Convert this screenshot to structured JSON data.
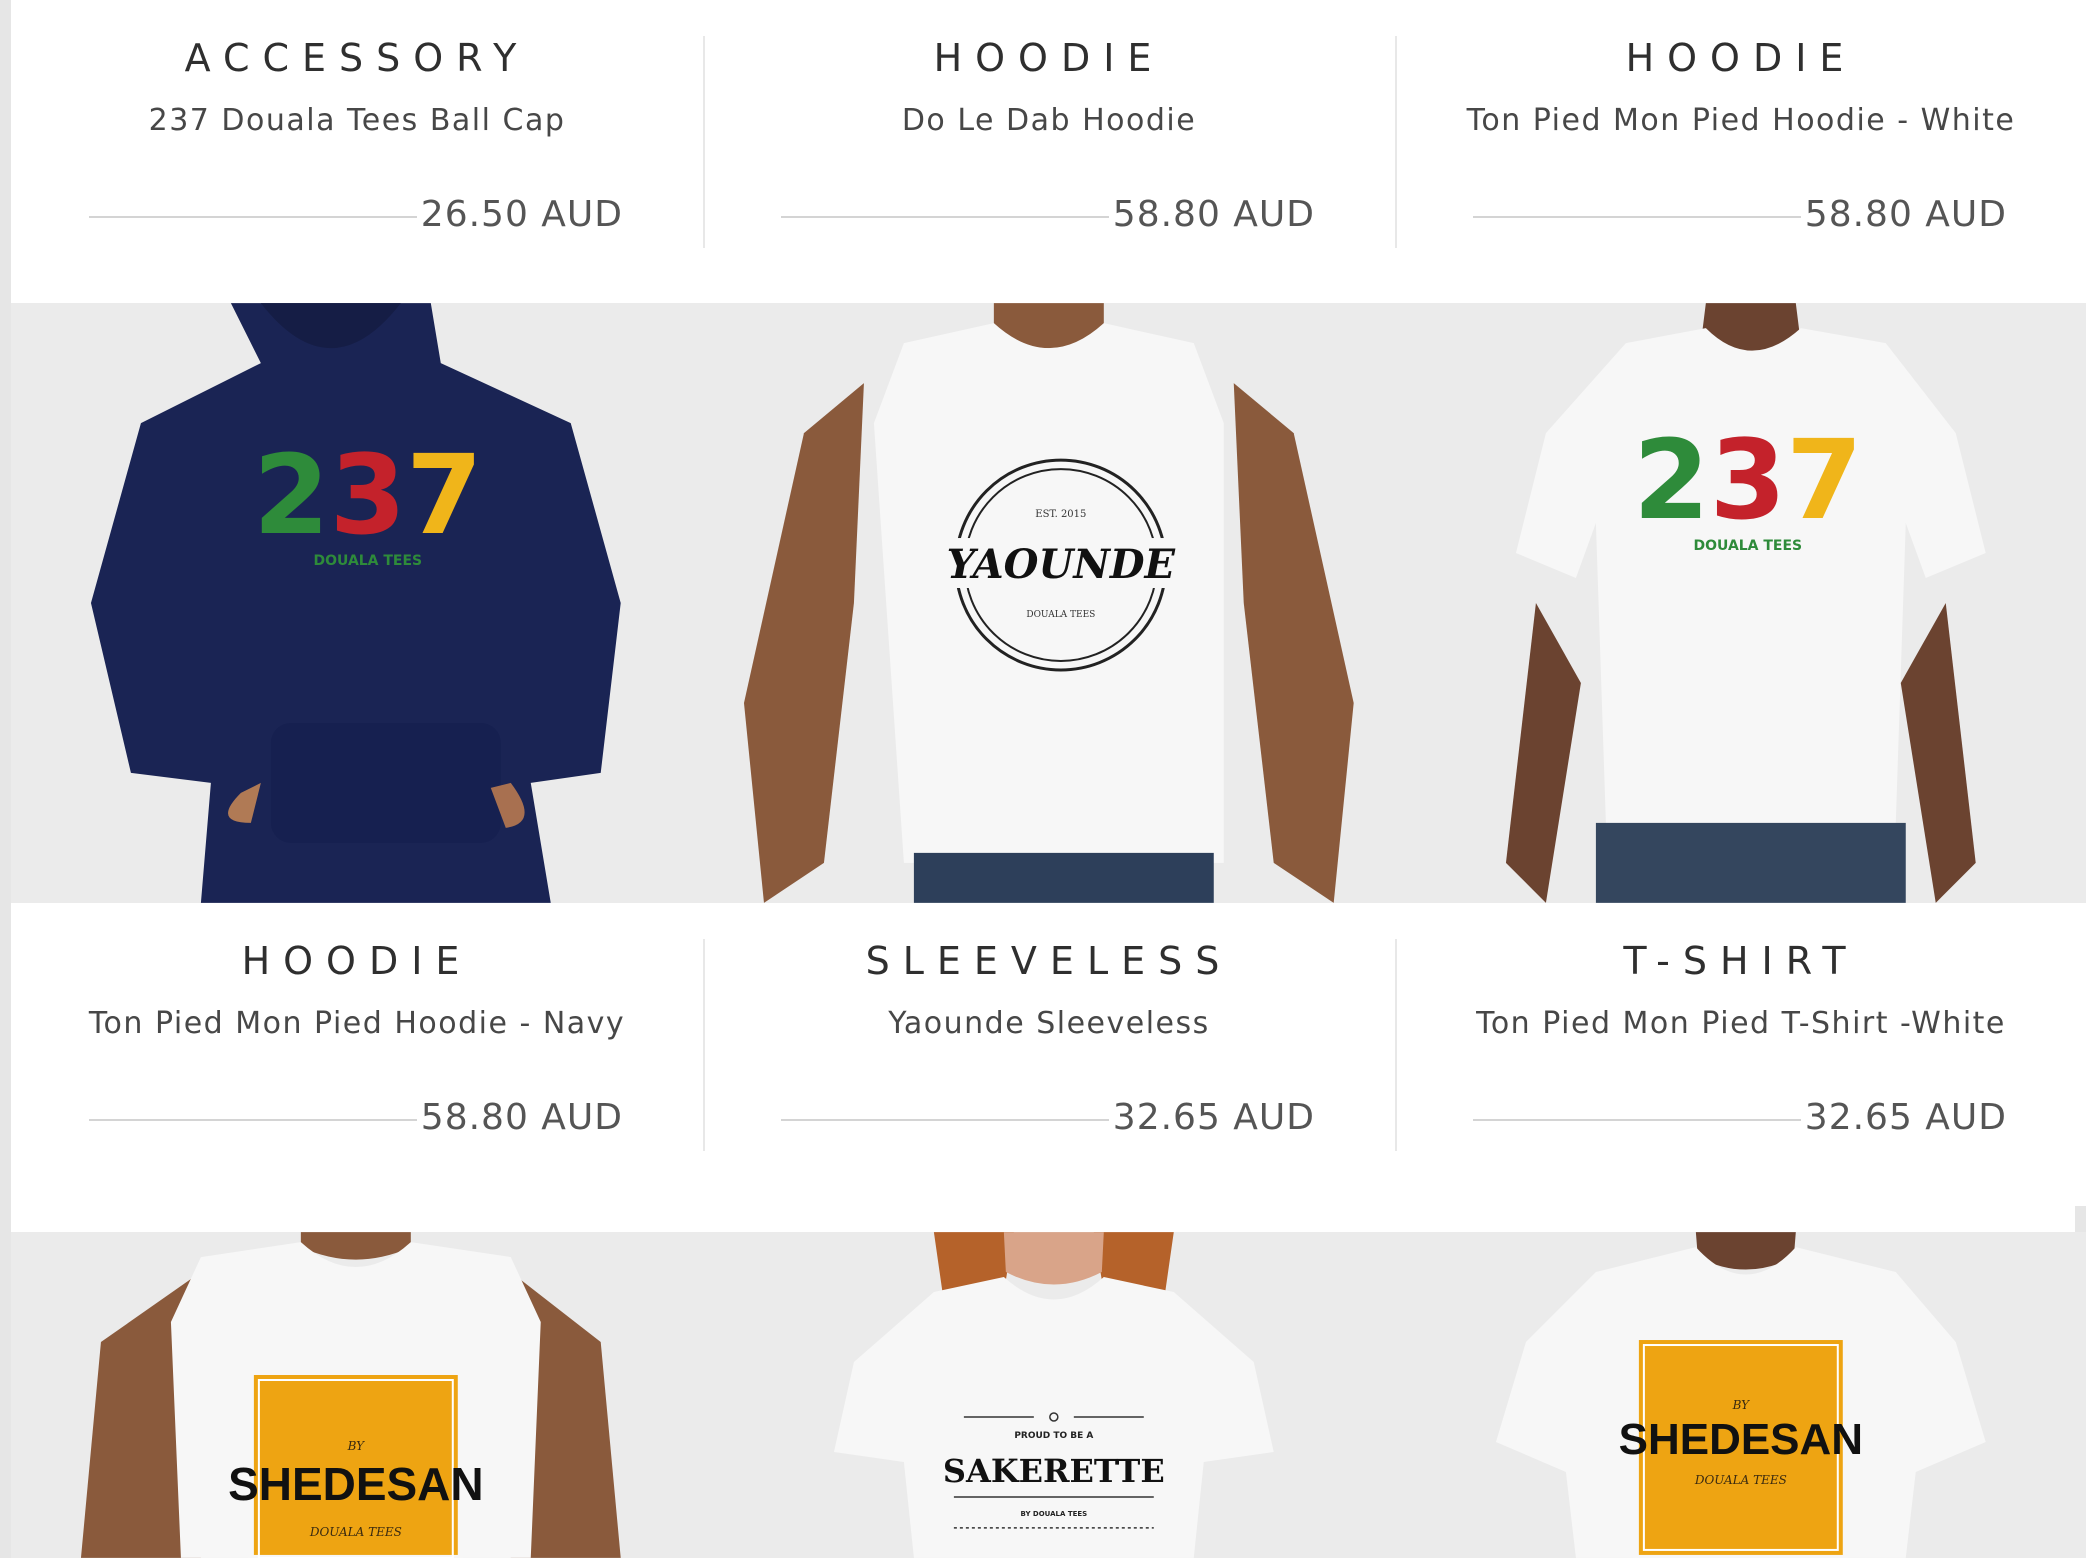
{
  "rows": [
    {
      "items": [
        {
          "category": "ACCESSORY",
          "name": "237 Douala Tees Ball Cap",
          "price": "26.50 AUD"
        },
        {
          "category": "HOODIE",
          "name": "Do Le Dab Hoodie",
          "price": "58.80 AUD"
        },
        {
          "category": "HOODIE",
          "name": "Ton Pied Mon Pied Hoodie - White",
          "price": "58.80 AUD"
        }
      ]
    },
    {
      "items": [
        {
          "category": "HOODIE",
          "name": "Ton Pied Mon Pied Hoodie - Navy",
          "price": "58.80 AUD"
        },
        {
          "category": "SLEEVELESS",
          "name": "Yaounde Sleeveless",
          "price": "32.65 AUD"
        },
        {
          "category": "T-SHIRT",
          "name": "Ton Pied Mon Pied T-Shirt -White",
          "price": "32.65 AUD"
        }
      ]
    }
  ],
  "images_row1": [
    {
      "design": "237 hoodie",
      "big": "237",
      "small": "DOUALA TEES",
      "garment_color": "#1a2454"
    },
    {
      "design": "yaounde sleeveless",
      "top": "EST. 2015",
      "big": "YAOUNDE",
      "small": "DOUALA TEES",
      "garment_color": "#f7f7f7"
    },
    {
      "design": "237 tee",
      "big": "237",
      "small": "DOUALA TEES",
      "garment_color": "#f7f7f7"
    }
  ],
  "images_row2": [
    {
      "design": "shedesan sleeveless",
      "top": "BY",
      "big": "SHEDESAN",
      "small": "DOUALA TEES",
      "badge_color": "#eea412"
    },
    {
      "design": "sakerette tee",
      "top": "PROUD TO BE A",
      "big": "SAKERETTE",
      "small": "BY DOUALA TEES"
    },
    {
      "design": "shedesan tee",
      "top": "BY",
      "big": "SHEDESAN",
      "small": "DOUALA TEES",
      "badge_color": "#eea412"
    }
  ],
  "colors": {
    "green": "#2e8b3a",
    "red": "#c4222b",
    "yellow": "#f0b51a",
    "text": "#2f2f2f"
  }
}
